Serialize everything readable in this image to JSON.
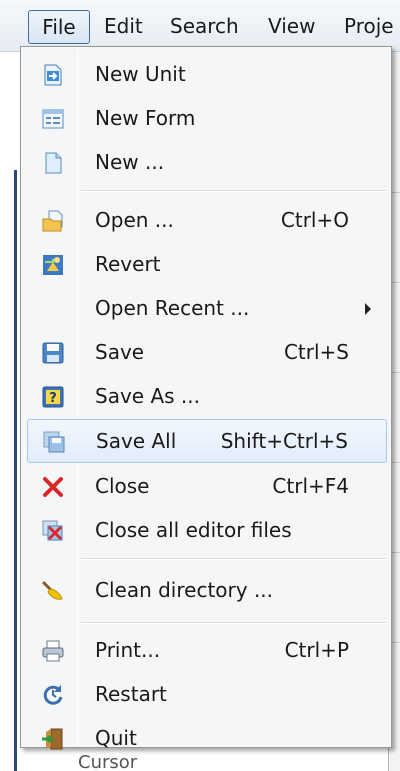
{
  "menubar": {
    "items": [
      "File",
      "Edit",
      "Search",
      "View",
      "Proje"
    ]
  },
  "menu": {
    "items": [
      {
        "label": "New Unit",
        "shortcut": "",
        "icon": "new-unit-icon"
      },
      {
        "label": "New Form",
        "shortcut": "",
        "icon": "new-form-icon"
      },
      {
        "label": "New ...",
        "shortcut": "",
        "icon": "new-file-icon"
      },
      {
        "label": "Open ...",
        "shortcut": "Ctrl+O",
        "icon": "open-icon"
      },
      {
        "label": "Revert",
        "shortcut": "",
        "icon": "revert-icon"
      },
      {
        "label": "Open Recent ...",
        "shortcut": "",
        "icon": ""
      },
      {
        "label": "Save",
        "shortcut": "Ctrl+S",
        "icon": "save-icon"
      },
      {
        "label": "Save As ...",
        "shortcut": "",
        "icon": "save-as-icon"
      },
      {
        "label": "Save All",
        "shortcut": "Shift+Ctrl+S",
        "icon": "save-all-icon"
      },
      {
        "label": "Close",
        "shortcut": "Ctrl+F4",
        "icon": "close-icon"
      },
      {
        "label": "Close all editor files",
        "shortcut": "",
        "icon": "close-all-icon"
      },
      {
        "label": "Clean directory ...",
        "shortcut": "",
        "icon": "clean-directory-icon"
      },
      {
        "label": "Print...",
        "shortcut": "Ctrl+P",
        "icon": "print-icon"
      },
      {
        "label": "Restart",
        "shortcut": "",
        "icon": "restart-icon"
      },
      {
        "label": "Quit",
        "shortcut": "",
        "icon": "quit-icon"
      }
    ]
  },
  "background": {
    "bottom_text": "Cursor"
  },
  "colors": {
    "highlight": "#e1ecf9",
    "highlight_border": "#a8c8ec",
    "close_red": "#d8282a"
  }
}
